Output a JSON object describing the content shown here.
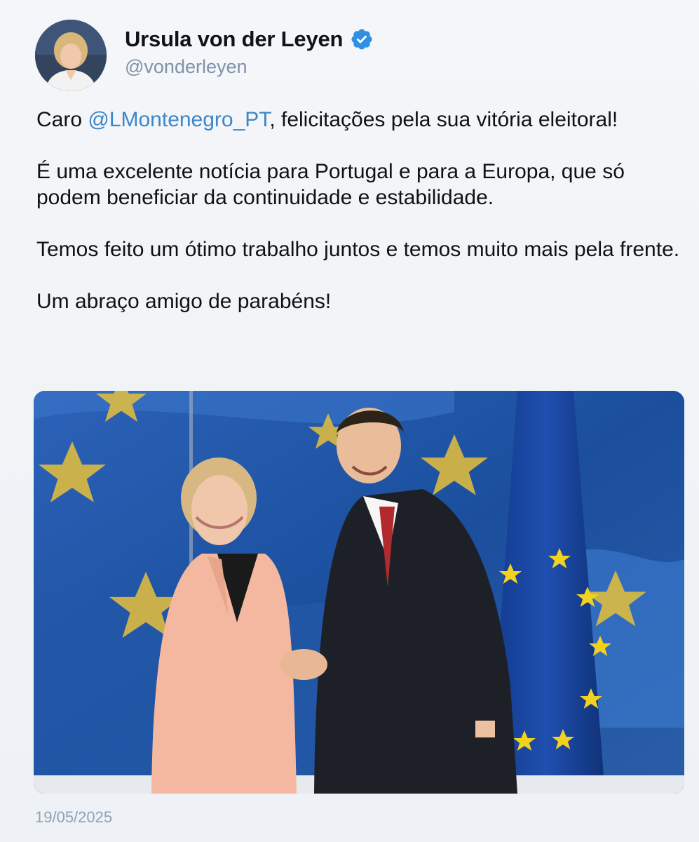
{
  "author": {
    "name": "Ursula von der Leyen",
    "handle": "@vonderleyen"
  },
  "tweet": {
    "p1_prefix": "Caro ",
    "p1_mention": "@LMontenegro_PT",
    "p1_suffix": ", felicitações pela sua vitória eleitoral!",
    "p2": "É uma excelente notícia para Portugal e para a Europa, que só podem beneficiar da continuidade e estabilidade.",
    "p3": "Temos feito um ótimo trabalho juntos e temos muito mais pela frente.",
    "p4": "Um abraço amigo de parabéns!"
  },
  "date": "19/05/2025",
  "colors": {
    "mention": "#3d86c7",
    "verified": "#2f8fe3",
    "handle": "#7e93a8"
  },
  "icons": [
    "verified-badge-icon"
  ]
}
